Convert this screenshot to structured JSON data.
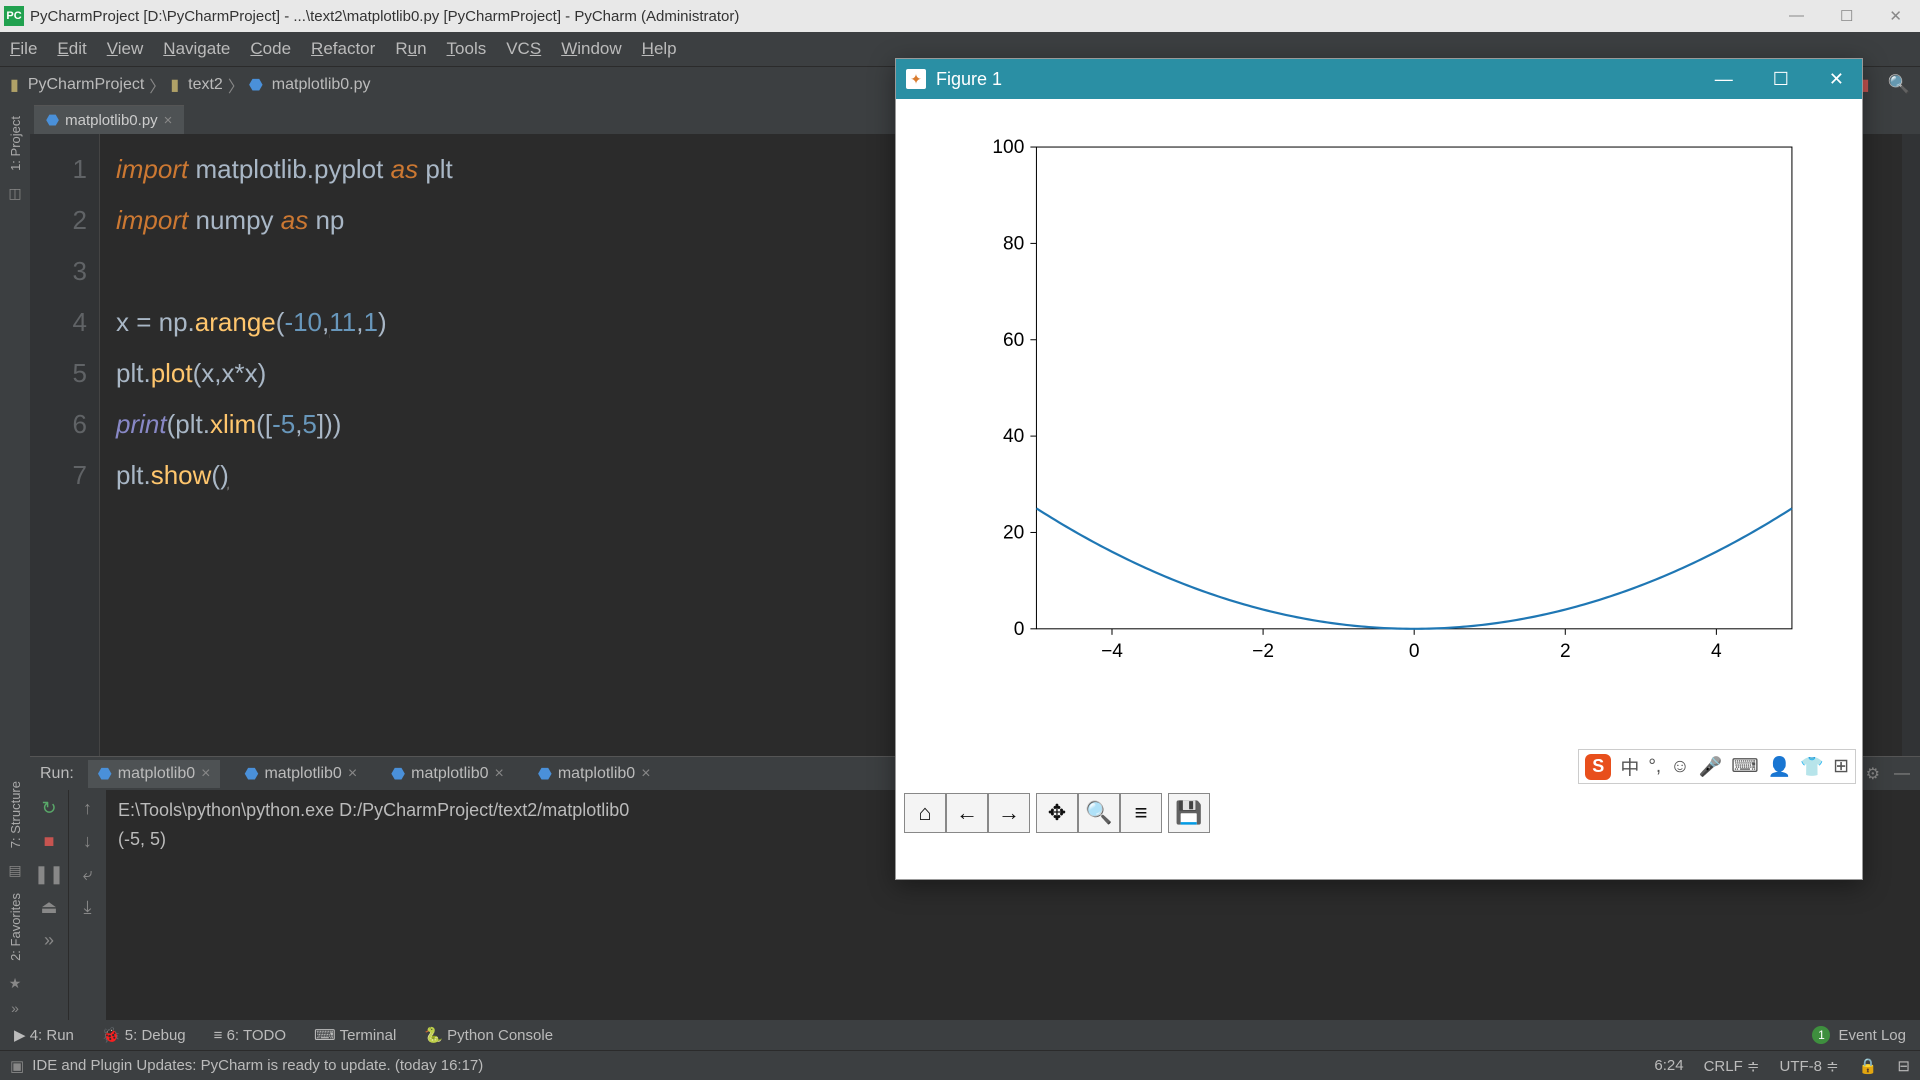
{
  "titlebar": {
    "app_icon_text": "PC",
    "title": "PyCharmProject [D:\\PyCharmProject] - ...\\text2\\matplotlib0.py [PyCharmProject] - PyCharm (Administrator)"
  },
  "menus": [
    "File",
    "Edit",
    "View",
    "Navigate",
    "Code",
    "Refactor",
    "Run",
    "Tools",
    "VCS",
    "Window",
    "Help"
  ],
  "breadcrumbs": {
    "project": "PyCharmProject",
    "folder": "text2",
    "file": "matplotlib0.py"
  },
  "editor_tab": {
    "filename": "matplotlib0.py"
  },
  "side_tools": {
    "project_label": "1: Project",
    "structure_label": "7: Structure",
    "favorites_label": "2: Favorites"
  },
  "code": {
    "lines": [
      1,
      2,
      3,
      4,
      5,
      6,
      7
    ],
    "current_line": 6,
    "tokens": {
      "import": "import",
      "as": "as",
      "matplotlib_pyplot": "matplotlib.pyplot",
      "plt": "plt",
      "numpy": "numpy",
      "np": "np",
      "x": "x",
      "eq": " = ",
      "np_dot": "np.",
      "arange": "arange",
      "neg10": "-10",
      "eleven": "11",
      "one": "1",
      "plt_dot": "plt.",
      "plot": "plot",
      "show": "show",
      "xlim": "xlim",
      "print": "print",
      "neg5": "-5",
      "five": "5",
      "lparen": "(",
      "rparen": ")",
      "lbrack": "[",
      "rbrack": "]",
      "comma": ",",
      "star": "*"
    }
  },
  "run_panel": {
    "label": "Run:",
    "tabs": [
      "matplotlib0",
      "matplotlib0",
      "matplotlib0",
      "matplotlib0"
    ],
    "output_line1": "E:\\Tools\\python\\python.exe D:/PyCharmProject/text2/matplotlib0",
    "output_line2": "(-5, 5)"
  },
  "bottom_tools": {
    "run": "4: Run",
    "debug": "5: Debug",
    "todo": "6: TODO",
    "terminal": "Terminal",
    "pyconsole": "Python Console",
    "eventlog": "Event Log",
    "eventcount": "1"
  },
  "statusbar": {
    "msg": "IDE and Plugin Updates: PyCharm is ready to update. (today 16:17)",
    "pos": "6:24",
    "lineend": "CRLF",
    "encoding": "UTF-8"
  },
  "figure": {
    "title": "Figure 1",
    "toolbar_icons": [
      "home",
      "back",
      "forward",
      "pan",
      "zoom",
      "configure",
      "save"
    ]
  },
  "ime": {
    "logo": "S",
    "lang": "中",
    "items": [
      "°,",
      "☺",
      "🎤",
      "⌨",
      "👤",
      "👕",
      "⊞"
    ]
  },
  "chart_data": {
    "type": "line",
    "x": [
      -5,
      -4,
      -3,
      -2,
      -1,
      0,
      1,
      2,
      3,
      4,
      5
    ],
    "y": [
      25,
      16,
      9,
      4,
      1,
      0,
      1,
      4,
      9,
      16,
      25
    ],
    "xlim": [
      -5,
      5
    ],
    "ylim": [
      0,
      100
    ],
    "xticks": [
      -4,
      -2,
      0,
      2,
      4
    ],
    "yticks": [
      0,
      20,
      40,
      60,
      80,
      100
    ],
    "xlabel": "",
    "ylabel": "",
    "title": ""
  }
}
